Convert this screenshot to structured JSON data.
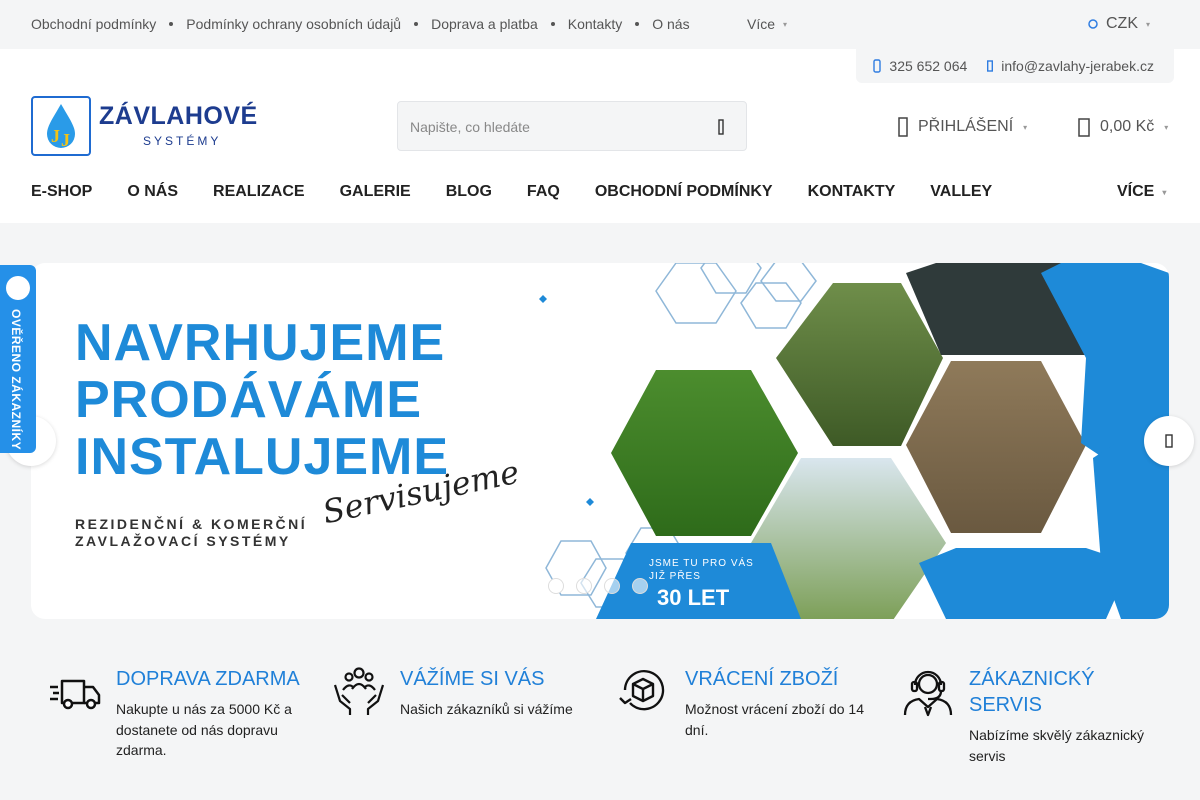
{
  "topbar": {
    "links": [
      "Obchodní podmínky",
      "Podmínky ochrany osobních údajů",
      "Doprava a platba",
      "Kontakty",
      "O nás"
    ],
    "more_label": "Více",
    "currency": "CZK"
  },
  "contact": {
    "phone": "325 652 064",
    "email": "info@zavlahy-jerabek.cz"
  },
  "logo": {
    "title": "ZÁVLAHOVÉ",
    "subtitle": "SYSTÉMY",
    "initials": "JJ"
  },
  "search": {
    "placeholder": "Napište, co hledáte"
  },
  "account": {
    "login_label": "PŘIHLÁŠENÍ",
    "cart_total": "0,00 Kč"
  },
  "mainnav": {
    "items": [
      "E-SHOP",
      "O NÁS",
      "REALIZACE",
      "GALERIE",
      "BLOG",
      "FAQ",
      "OBCHODNÍ PODMÍNKY",
      "KONTAKTY",
      "VALLEY"
    ],
    "more_label": "VÍCE"
  },
  "banner": {
    "line1": "NAVRHUJEME",
    "line2": "PRODÁVÁME",
    "line3": "INSTALUJEME",
    "script": "Servisujeme",
    "sub1": "REZIDENČNÍ & KOMERČNÍ",
    "sub2": "ZAVLAŽOVACÍ SYSTÉMY",
    "badge_line1": "JSME TU PRO VÁS",
    "badge_line2": "JIŽ PŘES",
    "badge_big": "30 LET",
    "slides": 4,
    "active_slide": 1
  },
  "verified_tab": {
    "label": "OVĚŘENO ZÁKAZNÍKY"
  },
  "features": [
    {
      "title": "DOPRAVA ZDARMA",
      "desc": "Nakupte u nás za 5000 Kč a dostanete od nás dopravu zdarma.",
      "icon": "truck-icon"
    },
    {
      "title": "VÁŽÍME SI VÁS",
      "desc": "Našich zákazníků si vážíme",
      "icon": "hands-people-icon"
    },
    {
      "title": "VRÁCENÍ ZBOŽÍ",
      "desc": "Možnost vrácení zboží do 14 dní.",
      "icon": "return-box-icon"
    },
    {
      "title": "ZÁKAZNICKÝ SERVIS",
      "desc": "Nabízíme skvělý zákaznický servis",
      "icon": "headset-agent-icon"
    }
  ],
  "colors": {
    "accent": "#2080d8",
    "logo_blue": "#1d3c8f",
    "banner_blue": "#1e8ad8"
  }
}
